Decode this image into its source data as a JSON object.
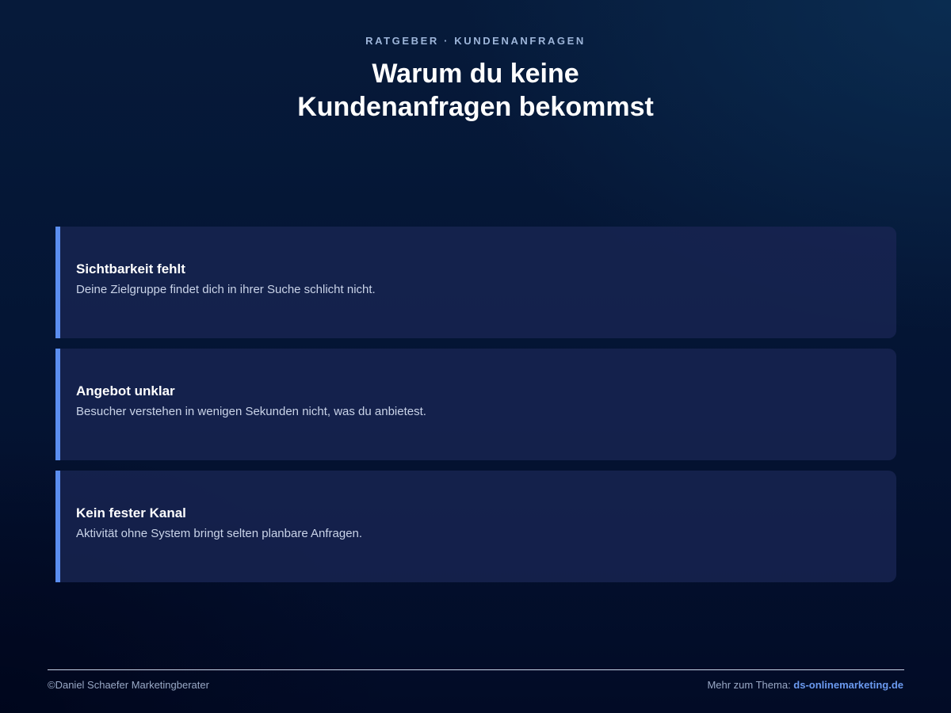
{
  "header": {
    "kicker": "RATGEBER · KUNDENANFRAGEN",
    "title_line1": "Warum du keine",
    "title_line2": "Kundenanfragen bekommst"
  },
  "cards": [
    {
      "title": "Sichtbarkeit fehlt",
      "text": "Deine Zielgruppe findet dich in ihrer Suche schlicht nicht."
    },
    {
      "title": "Angebot unklar",
      "text": "Besucher verstehen in wenigen Sekunden nicht, was du anbietest."
    },
    {
      "title": "Kein fester Kanal",
      "text": "Aktivität ohne System bringt selten planbare Anfragen."
    }
  ],
  "footer": {
    "copyright": "©Daniel Schaefer Marketingberater",
    "more_label": "Mehr zum Thema: ",
    "link_text": "ds-onlinemarketing.de"
  },
  "colors": {
    "accent": "#5b8ef0",
    "link": "#6b9af0",
    "card_background": "#182452",
    "background": "#041433"
  }
}
